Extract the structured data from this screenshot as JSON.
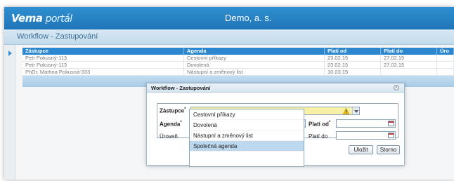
{
  "app": {
    "logo_main": "Vema",
    "logo_tail": "portál",
    "company": "Demo, a. s.",
    "module_title": "Workflow - Zastupování"
  },
  "grid": {
    "columns": [
      "Zástupce",
      "Agenda",
      "Platí od",
      "Platí do",
      "Úro"
    ],
    "rows": [
      [
        "Petr Pokusný-113",
        "Cestovní příkazy",
        "23.02.15",
        "27.02.15",
        ""
      ],
      [
        "Petr Pokusný-113",
        "Dovolená",
        "23.02.15",
        "27.02.15",
        ""
      ],
      [
        "PhDr. Martina Pokusná-333",
        "Nástupní a změnový list",
        "10.03.15",
        "",
        ""
      ]
    ]
  },
  "dialog": {
    "title": "Workflow - Zastupování",
    "labels": {
      "zastupce": "Zástupce",
      "agenda": "Agenda",
      "uroven": "Úroveň",
      "plati_od": "Platí od",
      "plati_do": "Platí do"
    },
    "required_mark": "*",
    "buttons": {
      "save": "Uložit",
      "cancel": "Storno"
    }
  },
  "agenda_options": [
    "Cestovní příkazy",
    "Dovolená",
    "Nástupní a změnový list",
    "Společná agenda"
  ],
  "colors": {
    "header_blue": "#1f75b8",
    "grid_header": "#2b87cf",
    "required_field": "#f8f0a6",
    "warning": "#f2c20f"
  }
}
